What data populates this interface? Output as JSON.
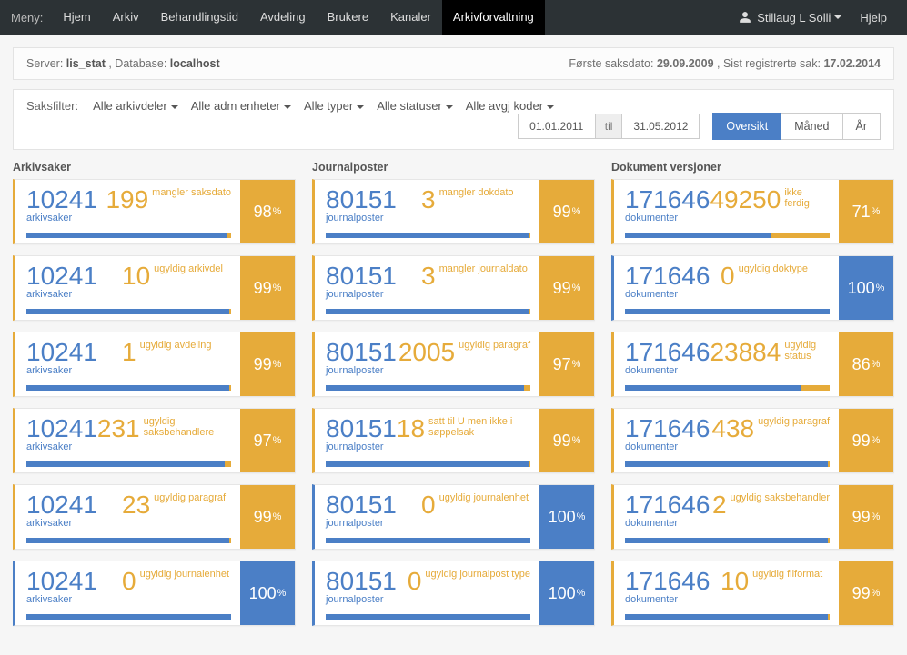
{
  "navbar": {
    "brand": "Meny:",
    "items": [
      "Hjem",
      "Arkiv",
      "Behandlingstid",
      "Avdeling",
      "Brukere",
      "Kanaler",
      "Arkivforvaltning"
    ],
    "active_index": 6,
    "user": "Stillaug L Solli",
    "help": "Hjelp"
  },
  "infobar": {
    "server_label": "Server:",
    "server": "lis_stat",
    "db_label": ", Database:",
    "db": "localhost",
    "first_label": "Første saksdato:",
    "first": "29.09.2009",
    "last_label": ", Sist registrerte sak:",
    "last": "17.02.2014"
  },
  "filter": {
    "label": "Saksfilter:",
    "dropdowns": [
      "Alle arkivdeler",
      "Alle adm enheter",
      "Alle typer",
      "Alle statuser",
      "Alle avgj koder"
    ],
    "date_from": "01.01.2011",
    "date_to": "31.05.2012",
    "til": "til",
    "views": [
      "Oversikt",
      "Måned",
      "År"
    ],
    "view_active": 0
  },
  "columns": [
    {
      "title": "Arkivsaker",
      "cards": [
        {
          "total": "10241",
          "total_sub": "arkivsaker",
          "issue": "199",
          "issue_sub": "mangler saksdato",
          "pct": "98",
          "style": "warn",
          "fill": 98
        },
        {
          "total": "10241",
          "total_sub": "arkivsaker",
          "issue": "10",
          "issue_sub": "ugyldig arkivdel",
          "pct": "99",
          "style": "warn",
          "fill": 99
        },
        {
          "total": "10241",
          "total_sub": "arkivsaker",
          "issue": "1",
          "issue_sub": "ugyldig avdeling",
          "pct": "99",
          "style": "warn",
          "fill": 99
        },
        {
          "total": "10241",
          "total_sub": "arkivsaker",
          "issue": "231",
          "issue_sub": "ugyldig saksbehandlere",
          "pct": "97",
          "style": "warn",
          "fill": 97
        },
        {
          "total": "10241",
          "total_sub": "arkivsaker",
          "issue": "23",
          "issue_sub": "ugyldig paragraf",
          "pct": "99",
          "style": "warn",
          "fill": 99
        },
        {
          "total": "10241",
          "total_sub": "arkivsaker",
          "issue": "0",
          "issue_sub": "ugyldig journalenhet",
          "pct": "100",
          "style": "blue",
          "fill": 100
        }
      ]
    },
    {
      "title": "Journalposter",
      "cards": [
        {
          "total": "80151",
          "total_sub": "journalposter",
          "issue": "3",
          "issue_sub": "mangler dokdato",
          "pct": "99",
          "style": "warn",
          "fill": 99
        },
        {
          "total": "80151",
          "total_sub": "journalposter",
          "issue": "3",
          "issue_sub": "mangler journaldato",
          "pct": "99",
          "style": "warn",
          "fill": 99
        },
        {
          "total": "80151",
          "total_sub": "journalposter",
          "issue": "2005",
          "issue_sub": "ugyldig paragraf",
          "pct": "97",
          "style": "warn",
          "fill": 97
        },
        {
          "total": "80151",
          "total_sub": "journalposter",
          "issue": "18",
          "issue_sub": "satt til U men ikke i søppelsak",
          "pct": "99",
          "style": "warn",
          "fill": 99
        },
        {
          "total": "80151",
          "total_sub": "journalposter",
          "issue": "0",
          "issue_sub": "ugyldig journalenhet",
          "pct": "100",
          "style": "blue",
          "fill": 100
        },
        {
          "total": "80151",
          "total_sub": "journalposter",
          "issue": "0",
          "issue_sub": "ugyldig journalpost type",
          "pct": "100",
          "style": "blue",
          "fill": 100
        }
      ]
    },
    {
      "title": "Dokument versjoner",
      "cards": [
        {
          "total": "171646",
          "total_sub": "dokumenter",
          "issue": "49250",
          "issue_sub": "ikke ferdig",
          "pct": "71",
          "style": "warn",
          "fill": 71
        },
        {
          "total": "171646",
          "total_sub": "dokumenter",
          "issue": "0",
          "issue_sub": "ugyldig doktype",
          "pct": "100",
          "style": "blue",
          "fill": 100
        },
        {
          "total": "171646",
          "total_sub": "dokumenter",
          "issue": "23884",
          "issue_sub": "ugyldig status",
          "pct": "86",
          "style": "warn",
          "fill": 86
        },
        {
          "total": "171646",
          "total_sub": "dokumenter",
          "issue": "438",
          "issue_sub": "ugyldig paragraf",
          "pct": "99",
          "style": "warn",
          "fill": 99
        },
        {
          "total": "171646",
          "total_sub": "dokumenter",
          "issue": "2",
          "issue_sub": "ugyldig saksbehandler",
          "pct": "99",
          "style": "warn",
          "fill": 99
        },
        {
          "total": "171646",
          "total_sub": "dokumenter",
          "issue": "10",
          "issue_sub": "ugyldig filformat",
          "pct": "99",
          "style": "warn",
          "fill": 99
        }
      ]
    }
  ]
}
